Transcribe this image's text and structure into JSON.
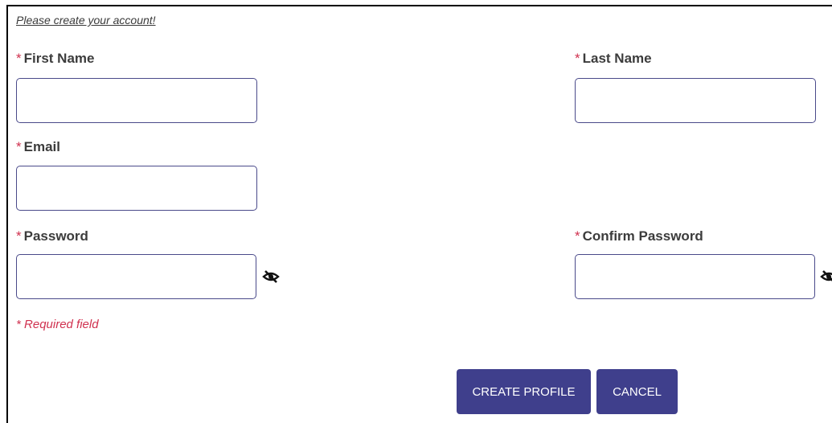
{
  "form": {
    "intro": "Please create your account!",
    "required_marker": "*",
    "first_name": {
      "label": "First Name",
      "value": "",
      "placeholder": ""
    },
    "last_name": {
      "label": "Last Name",
      "value": "",
      "placeholder": ""
    },
    "email": {
      "label": "Email",
      "value": "",
      "placeholder": ""
    },
    "password": {
      "label": "Password",
      "value": "",
      "placeholder": "",
      "toggle_icon": "eye-slash-icon"
    },
    "confirm_password": {
      "label": "Confirm Password",
      "value": "",
      "placeholder": "",
      "toggle_icon": "eye-slash-icon"
    },
    "required_note": "Required field"
  },
  "buttons": {
    "create_label": "CREATE PROFILE",
    "cancel_label": "CANCEL"
  },
  "colors": {
    "accent": "#3f3f8c",
    "required": "#d0314f",
    "input_border": "#4a4a8a"
  }
}
